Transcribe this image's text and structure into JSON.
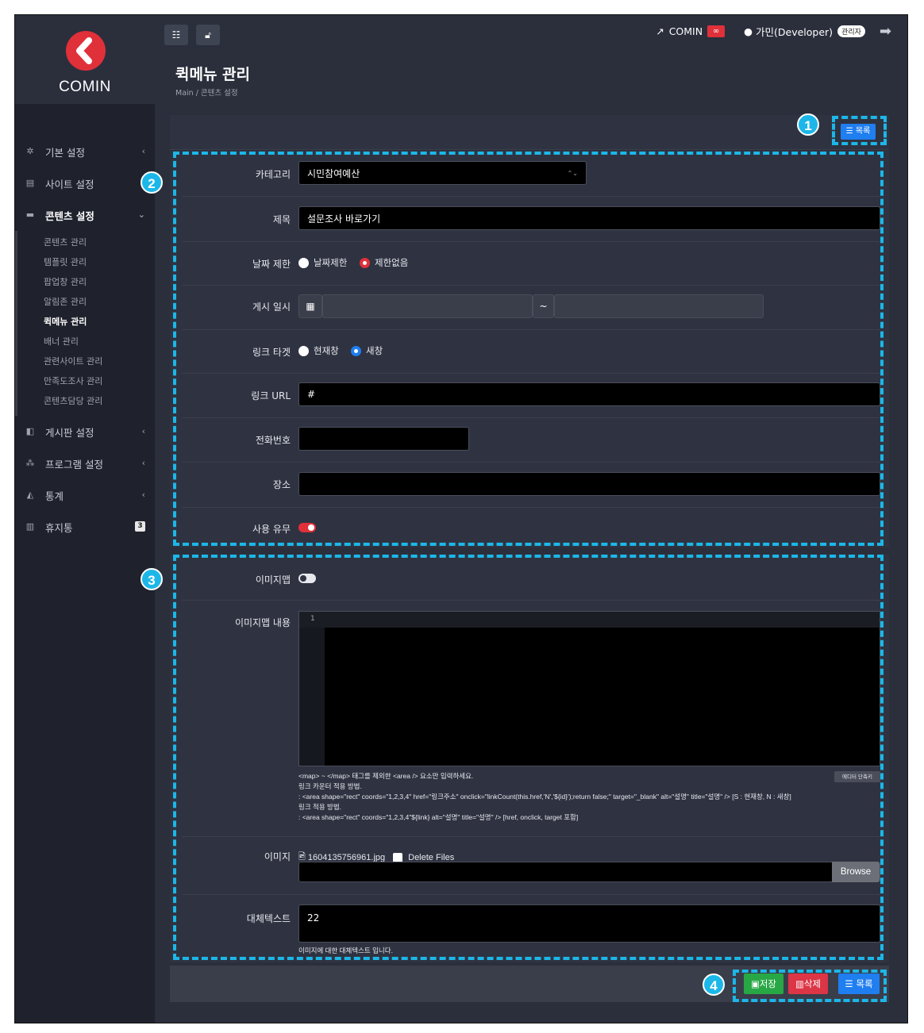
{
  "brand": {
    "name": "COMIN"
  },
  "sidebar": {
    "items": [
      {
        "label": "기본 설정",
        "icon": "gears-icon",
        "chevron": "‹"
      },
      {
        "label": "사이트 설정",
        "icon": "server-icon",
        "chevron": ""
      },
      {
        "label": "콘텐츠 설정",
        "icon": "hdd-icon",
        "chevron": "⌄"
      }
    ],
    "sub_items": [
      "콘텐츠 관리",
      "템플릿 관리",
      "팝업창 관리",
      "알림존 관리",
      "퀵메뉴 관리",
      "배너 관리",
      "관련사이트 관리",
      "만족도조사 관리",
      "콘텐츠담당 관리"
    ],
    "items_after": [
      {
        "label": "게시판 설정",
        "icon": "comments-icon",
        "chevron": "‹"
      },
      {
        "label": "프로그램 설정",
        "icon": "sitemap-icon",
        "chevron": "‹"
      },
      {
        "label": "통계",
        "icon": "chart-area-icon",
        "chevron": "‹"
      },
      {
        "label": "휴지통",
        "icon": "trash-icon",
        "badge": "3"
      }
    ]
  },
  "topbar": {
    "site_link": "COMIN",
    "user": "가민(Developer)",
    "role": "관리자"
  },
  "page": {
    "title": "퀵메뉴 관리",
    "breadcrumb": "Main  /  콘텐츠 설정"
  },
  "markers": [
    "1",
    "2",
    "3",
    "4"
  ],
  "form": {
    "category": {
      "label": "카테고리",
      "value": "시민참여예산",
      "arrow": "⌃⌄"
    },
    "title": {
      "label": "제목",
      "value": "설문조사 바로가기"
    },
    "date_limit": {
      "label": "날짜 제한",
      "options": [
        "날짜제한",
        "제한없음"
      ],
      "selected": "제한없음"
    },
    "post_date": {
      "label": "게시 일시",
      "separator": "~",
      "start": "",
      "end": ""
    },
    "link_target": {
      "label": "링크 타겟",
      "options": [
        "현재창",
        "새창"
      ],
      "selected": "새창"
    },
    "link_url": {
      "label": "링크 URL",
      "value": "#"
    },
    "phone": {
      "label": "전화번호",
      "value": ""
    },
    "place": {
      "label": "장소",
      "value": ""
    },
    "use": {
      "label": "사용 유무",
      "on": true
    },
    "imagemap": {
      "label": "이미지맵",
      "on": false
    },
    "imagemap_content": {
      "label": "이미지맵 내용",
      "line_no": "1",
      "editor_toggle": "에디터 단축키"
    },
    "help": [
      "<map> ~ </map> 태그를 제외한 <area /> 요소만 입력하세요.",
      "링크 카운터 적용 방법.",
      ": <area shape=\"rect\" coords=\"1,2,3,4\" href=\"링크주소\" onclick=\"linkCount(this.href,'N','${id}');return false;\" target=\"_blank\" alt=\"설명\" title=\"설명\" /> [S : 현재창, N : 새창]",
      "링크 적용 방법.",
      ": <area shape=\"rect\" coords=\"1,2,3,4\"${link} alt=\"설명\" title=\"설명\" /> [href, onclick, target 포함]"
    ],
    "image": {
      "label": "이미지",
      "filename": "1604135756961.jpg",
      "delete_label": "Delete Files",
      "browse": "Browse"
    },
    "alt_text": {
      "label": "대체텍스트",
      "value": "22",
      "hint": "이미지에 대한 대체텍스트 입니다."
    }
  },
  "buttons": {
    "list": "목록",
    "save": "저장",
    "delete": "삭제"
  },
  "colors": {
    "accent": "#1cb7e8",
    "brand_red": "#e0303a",
    "primary": "#1f7ef0",
    "success": "#28a745",
    "danger": "#dc3545"
  }
}
